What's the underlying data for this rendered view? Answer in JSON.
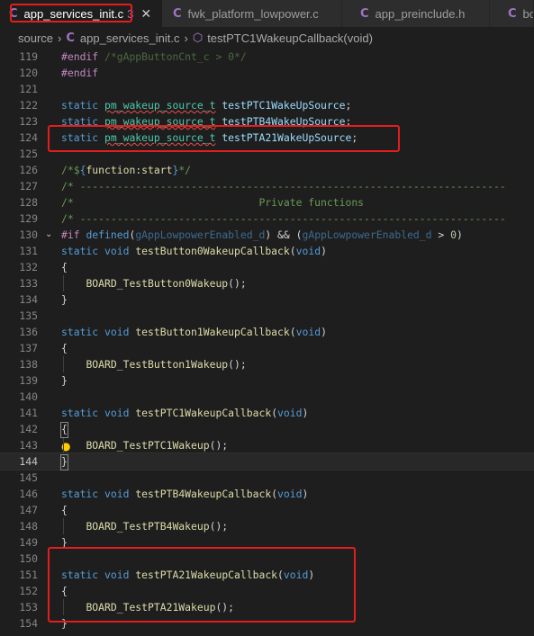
{
  "tabs": [
    {
      "icon": "C",
      "label": "app_services_init.c",
      "close": "✕"
    },
    {
      "icon": "C",
      "label": "fwk_platform_lowpower.c"
    },
    {
      "icon": "C",
      "label": "app_preinclude.h"
    },
    {
      "icon": "C",
      "label": "boa"
    }
  ],
  "breadcrumb": {
    "folder": "source",
    "file": "app_services_init.c",
    "symbol": "testPTC1WakeupCallback(void)"
  },
  "colors": {
    "accent_c": "#a074c4",
    "highlight": "#e51d1d",
    "bg": "#1e1e1e"
  },
  "lines": [
    {
      "n": "119",
      "text": "#endif /*gAppButtonCnt_c > 0*/"
    },
    {
      "n": "120",
      "text": "#endif"
    },
    {
      "n": "121",
      "text": ""
    },
    {
      "n": "122",
      "text": "static pm_wakeup_source_t testPTC1WakeUpSource;"
    },
    {
      "n": "123",
      "text": "static pm_wakeup_source_t testPTB4WakeUpSource;"
    },
    {
      "n": "124",
      "text": "static pm_wakeup_source_t testPTA21WakeUpSource;"
    },
    {
      "n": "125",
      "text": ""
    },
    {
      "n": "126",
      "text": "/*${function:start}*/"
    },
    {
      "n": "127",
      "text": "/* ---------------------------------------------------------------------"
    },
    {
      "n": "128",
      "text": "/*                              Private functions"
    },
    {
      "n": "129",
      "text": "/* ---------------------------------------------------------------------"
    },
    {
      "n": "130",
      "text": "#if defined(gAppLowpowerEnabled_d) && (gAppLowpowerEnabled_d > 0)"
    },
    {
      "n": "131",
      "text": "static void testButton0WakeupCallback(void)"
    },
    {
      "n": "132",
      "text": "{"
    },
    {
      "n": "133",
      "text": "    BOARD_TestButton0Wakeup();"
    },
    {
      "n": "134",
      "text": "}"
    },
    {
      "n": "135",
      "text": ""
    },
    {
      "n": "136",
      "text": "static void testButton1WakeupCallback(void)"
    },
    {
      "n": "137",
      "text": "{"
    },
    {
      "n": "138",
      "text": "    BOARD_TestButton1Wakeup();"
    },
    {
      "n": "139",
      "text": "}"
    },
    {
      "n": "140",
      "text": ""
    },
    {
      "n": "141",
      "text": "static void testPTC1WakeupCallback(void)"
    },
    {
      "n": "142",
      "text": "{"
    },
    {
      "n": "143",
      "text": "    BOARD_TestPTC1Wakeup();"
    },
    {
      "n": "144",
      "text": "}"
    },
    {
      "n": "145",
      "text": ""
    },
    {
      "n": "146",
      "text": "static void testPTB4WakeupCallback(void)"
    },
    {
      "n": "147",
      "text": "{"
    },
    {
      "n": "148",
      "text": "    BOARD_TestPTB4Wakeup();"
    },
    {
      "n": "149",
      "text": "}"
    },
    {
      "n": "150",
      "text": ""
    },
    {
      "n": "151",
      "text": "static void testPTA21WakeupCallback(void)"
    },
    {
      "n": "152",
      "text": "{"
    },
    {
      "n": "153",
      "text": "    BOARD_TestPTA21Wakeup();"
    },
    {
      "n": "154",
      "text": "}"
    }
  ]
}
